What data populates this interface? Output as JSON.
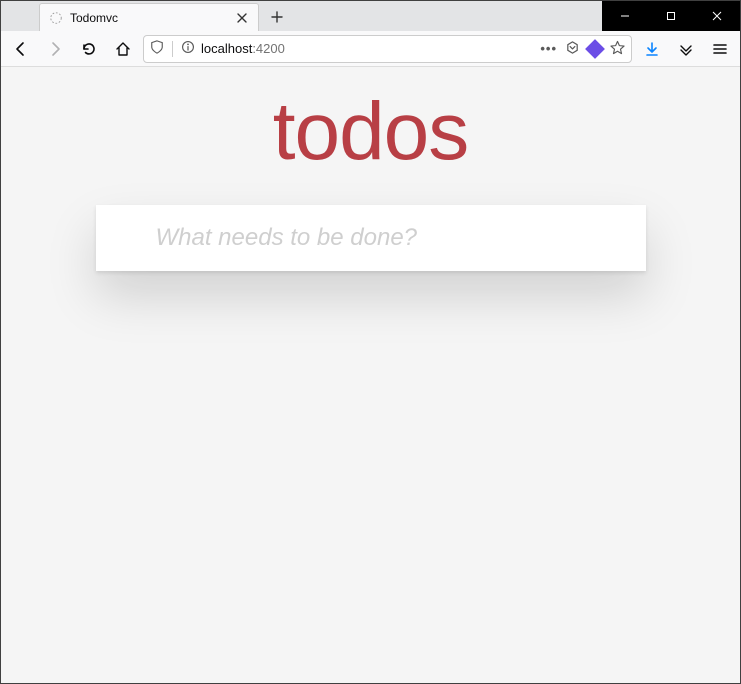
{
  "browser": {
    "tab_title": "Todomvc",
    "url_host": "localhost",
    "url_port": ":4200",
    "window_controls": {
      "min": "minimize",
      "max": "maximize",
      "close": "close"
    }
  },
  "app": {
    "title": "todos",
    "new_todo_placeholder": "What needs to be done?"
  },
  "colors": {
    "title": "#b83f45",
    "page_bg": "#f5f5f5"
  }
}
